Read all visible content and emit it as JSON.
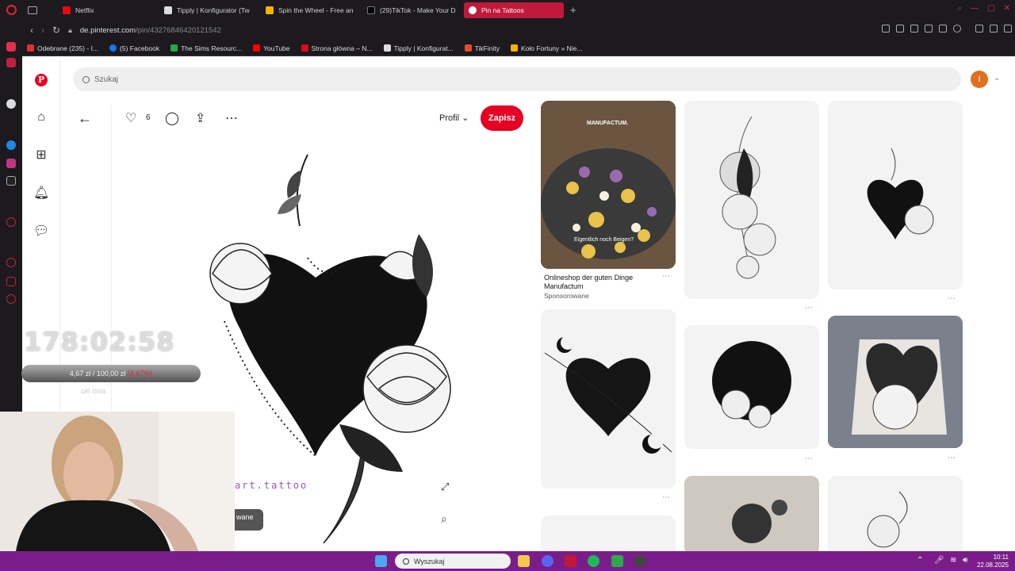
{
  "browser": {
    "tabs": [
      {
        "label": "Netflix",
        "color": "#e50914"
      },
      {
        "label": "Tipply | Konfigurator (Tw",
        "color": "#dddddd"
      },
      {
        "label": "Spin the Wheel - Free an",
        "color": "#f4b400"
      },
      {
        "label": "(29)TikTok - Make Your D",
        "color": "#000000"
      },
      {
        "label": "Pin na Tattoos",
        "color": "#e60023",
        "active": true
      }
    ],
    "url_host": "de.pinterest.com",
    "url_path": "/pin/43276846420121542",
    "bookmarks": [
      {
        "label": "Odebrane (235) - I...",
        "color": "#e03030"
      },
      {
        "label": "(5) Facebook",
        "color": "#1877f2"
      },
      {
        "label": "The Sims Resourc...",
        "color": "#2aa84a"
      },
      {
        "label": "YouTube",
        "color": "#ff0000"
      },
      {
        "label": "Strona główna – N...",
        "color": "#e50914"
      },
      {
        "label": "Tipply | Konfigurat...",
        "color": "#dddddd"
      },
      {
        "label": "TikFinity",
        "color": "#e94a2e"
      },
      {
        "label": "Koło Fortuny » Nie...",
        "color": "#f4b400"
      }
    ]
  },
  "pinterest": {
    "search_placeholder": "Szukaj",
    "avatar_letter": "I",
    "like_count": "6",
    "profile_label": "Profil",
    "save_label": "Zapisz",
    "watermark": "art.tattoo",
    "sponsored_title": "Onlineshop der guten Dinge Manufactum",
    "sponsored_sub": "Sponsorowane",
    "sponsored_brand": "MANUFACTUM.",
    "sponsored_caption": "Eigentlich noch Beigen?",
    "partial_badge": "wane"
  },
  "overlay": {
    "timer": "178:02:58",
    "goal": "4,67 zł / 100,00 zł",
    "goal_pct": "(4,67%)",
    "goal_label": "cel dnia"
  },
  "taskbar": {
    "search_placeholder": "Wyszukaj",
    "time": "10:11",
    "date": "22.08.2025"
  }
}
